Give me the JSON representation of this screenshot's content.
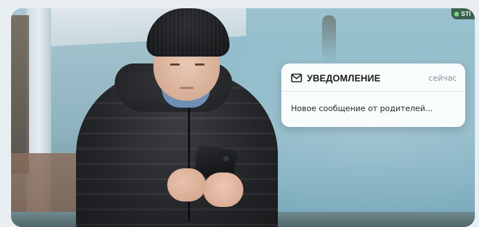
{
  "notification": {
    "icon": "envelope-icon",
    "title": "УВЕДОМЛЕНИЕ",
    "time": "сейчас",
    "message": "Новое сообщение от родителей..."
  },
  "watermark": {
    "label": "STI"
  },
  "colors": {
    "page_background": "#e9eef3",
    "notification_background": "#ffffff",
    "title_text": "#1c1c1e",
    "time_text": "#8a8f96"
  }
}
